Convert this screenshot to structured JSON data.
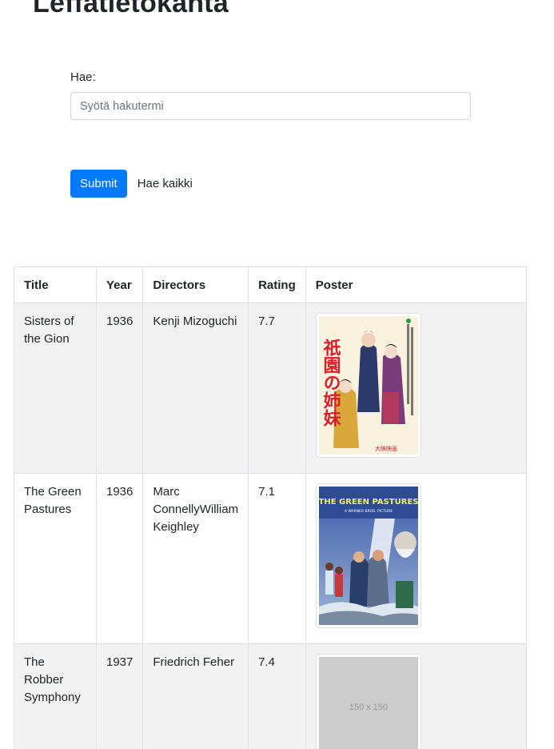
{
  "page": {
    "title": "Leffatietokanta"
  },
  "search": {
    "label": "Hae:",
    "placeholder": "Syötä hakutermi",
    "value": ""
  },
  "actions": {
    "submit_label": "Submit",
    "search_all_label": "Hae kaikki"
  },
  "table": {
    "headers": [
      "Title",
      "Year",
      "Directors",
      "Rating",
      "Poster"
    ],
    "rows": [
      {
        "title": "Sisters of the Gion",
        "year": "1936",
        "directors": "Kenji Mizoguchi",
        "rating": "7.7",
        "poster": {
          "kind": "image",
          "text": "祇園の姉妹",
          "footer": "大映映画"
        }
      },
      {
        "title": "The Green Pastures",
        "year": "1936",
        "directors": "Marc ConnellyWilliam Keighley",
        "rating": "7.1",
        "poster": {
          "kind": "image",
          "text": "THE GREEN PASTURES",
          "subtitle": "A WARNER BROS. PICTURE"
        }
      },
      {
        "title": "The Robber Symphony",
        "year": "1937",
        "directors": "Friedrich Feher",
        "rating": "7.4",
        "poster": {
          "kind": "placeholder",
          "text": "150 x 150"
        }
      }
    ]
  },
  "colors": {
    "primary": "#007bff",
    "row_stripe": "#f2f2f2",
    "border": "#dee2e6",
    "placeholder_gray": "#cccccc"
  }
}
